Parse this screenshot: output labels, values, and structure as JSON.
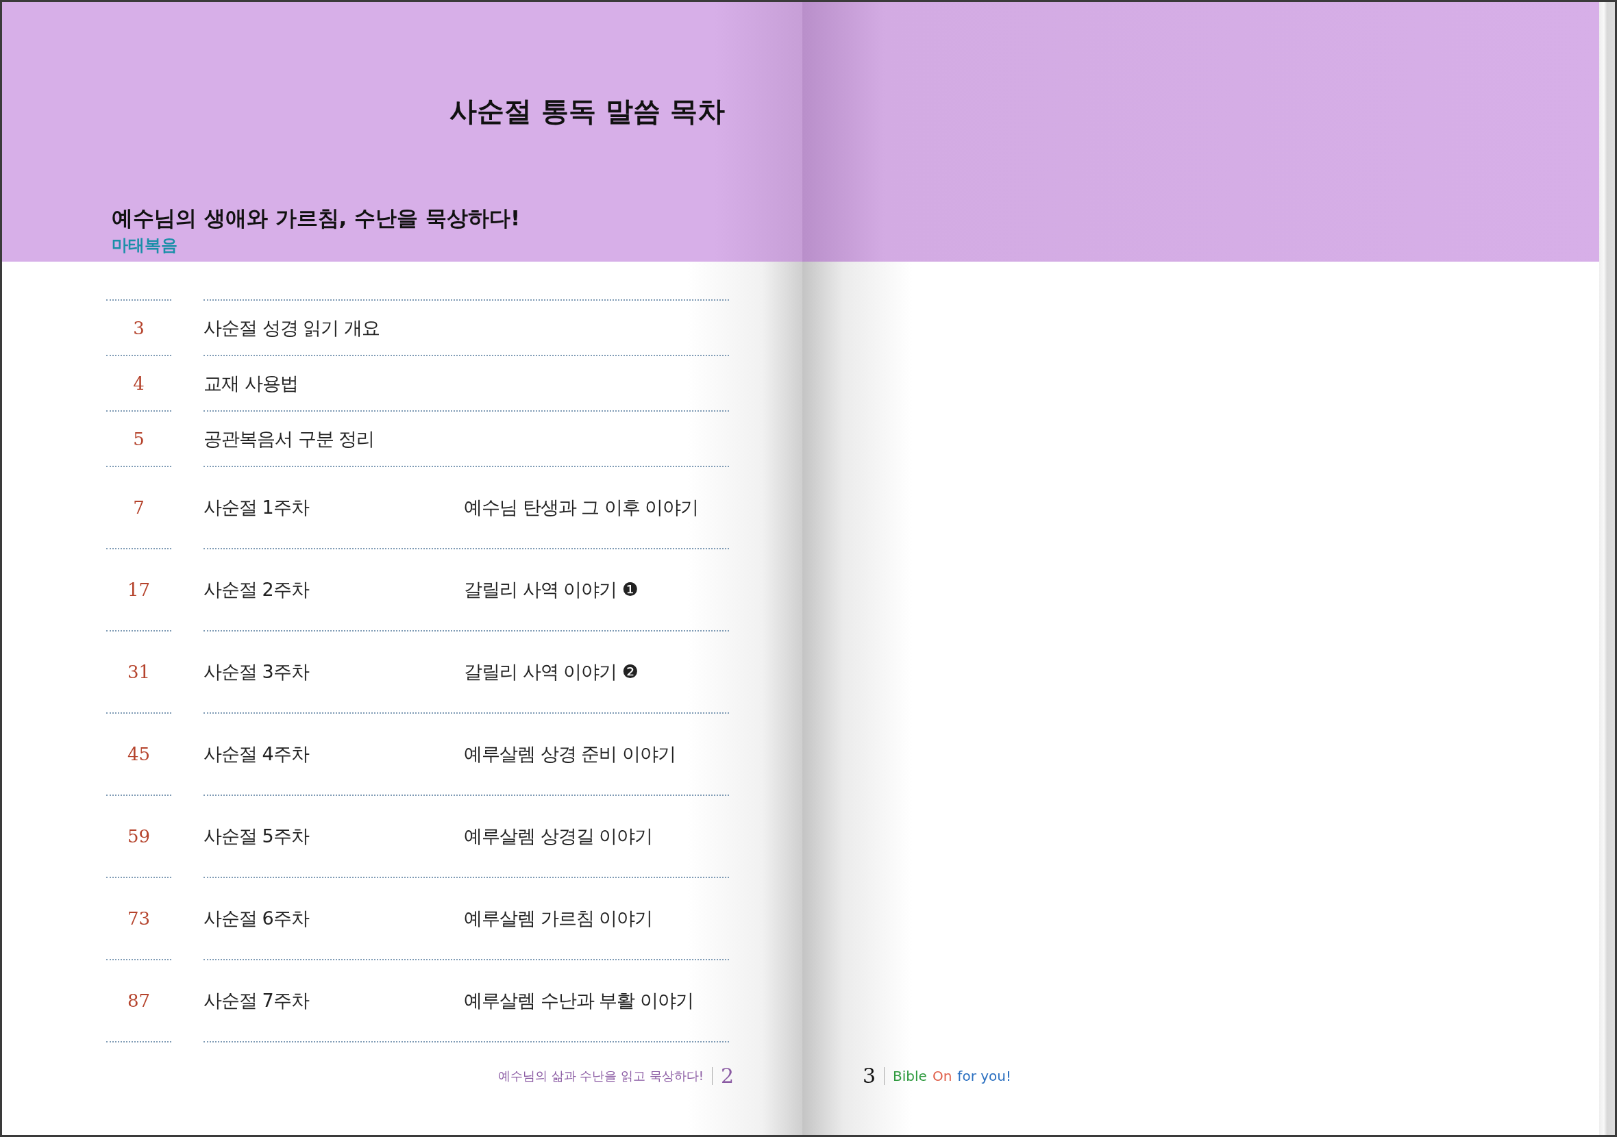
{
  "title": "사순절 통독 말씀 목차",
  "subtitle": "예수님의 생애와 가르침, 수난을 묵상하다!",
  "book": "마태복음",
  "rows": [
    {
      "kind": "short",
      "page": "3",
      "title": "사순절 성경 읽기 개요"
    },
    {
      "kind": "short",
      "page": "4",
      "title": "교재 사용법"
    },
    {
      "kind": "short",
      "page": "5",
      "title": "공관복음서 구분 정리"
    },
    {
      "kind": "week",
      "page": "7",
      "title": "사순절 1주차",
      "topic": "예수님 탄생과 그 이후 이야기"
    },
    {
      "kind": "week",
      "page": "17",
      "title": "사순절 2주차",
      "topic": "갈릴리 사역 이야기 ❶"
    },
    {
      "kind": "week",
      "page": "31",
      "title": "사순절 3주차",
      "topic": "갈릴리 사역 이야기 ❷"
    },
    {
      "kind": "week",
      "page": "45",
      "title": "사순절 4주차",
      "topic": "예루살렘 상경 준비 이야기"
    },
    {
      "kind": "week",
      "page": "59",
      "title": "사순절 5주차",
      "topic": "예루살렘 상경길 이야기"
    },
    {
      "kind": "week",
      "page": "73",
      "title": "사순절 6주차",
      "topic": "예루살렘 가르침 이야기"
    },
    {
      "kind": "week",
      "page": "87",
      "title": "사순절 7주차",
      "topic": "예루살렘 수난과 부활 이야기"
    }
  ],
  "footer_left": {
    "text": "예수님의 삶과 수난을 읽고 묵상하다!",
    "page": "2"
  },
  "footer_right": {
    "page": "3",
    "brand": [
      {
        "text": "Bible",
        "color": "#2e9a3e"
      },
      {
        "text": "On",
        "color": "#e0604a"
      },
      {
        "text": "for you!",
        "color": "#2a6fc0"
      }
    ]
  }
}
